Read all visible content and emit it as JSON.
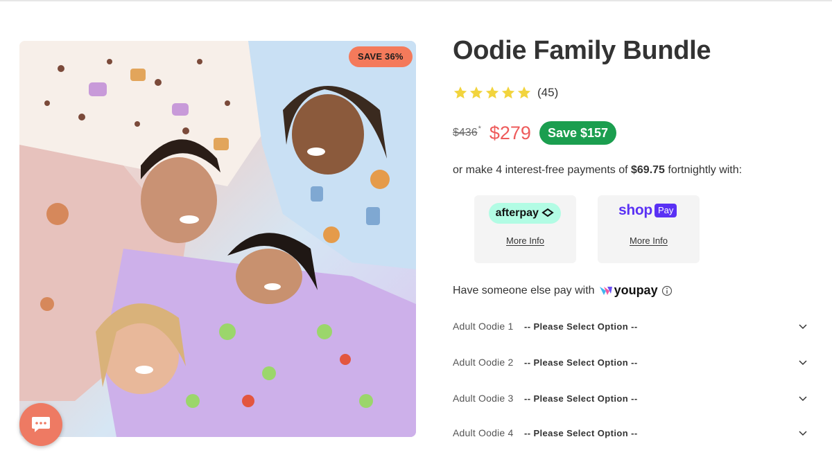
{
  "badge": {
    "save_percent": "SAVE 36%"
  },
  "product": {
    "title": "Oodie Family Bundle",
    "rating": {
      "stars": 5,
      "count": "(45)"
    },
    "price": {
      "old": "$436",
      "old_mark": "*",
      "new": "$279",
      "save": "Save $157"
    },
    "installments": {
      "prefix": "or make 4 interest-free payments of ",
      "amount": "$69.75",
      "suffix": " fortnightly with:"
    }
  },
  "payment_options": {
    "afterpay": {
      "logo_text": "afterpay",
      "link": "More Info"
    },
    "shoppay": {
      "logo_shop": "shop",
      "logo_pay": "Pay",
      "link": "More Info"
    }
  },
  "youpay": {
    "text": "Have someone else pay with",
    "logo_text": "youpay"
  },
  "options": [
    {
      "label": "Adult Oodie 1",
      "value": "-- Please Select Option --"
    },
    {
      "label": "Adult Oodie 2",
      "value": "-- Please Select Option --"
    },
    {
      "label": "Adult Oodie 3",
      "value": "-- Please Select Option --"
    },
    {
      "label": "Adult Oodie 4",
      "value": "-- Please Select Option --"
    }
  ],
  "colors": {
    "badge": "#f47a5b",
    "price_sale": "#ee5b5b",
    "save_pill": "#1b9e4f",
    "star": "#f2d43d",
    "afterpay": "#b2fce4",
    "shoppay": "#5a31f4",
    "chat": "#ee7a63"
  },
  "icons": {
    "star": "star-icon",
    "chevron": "chevron-down-icon",
    "chat": "chat-bubble-icon",
    "info": "info-icon",
    "afterpay_arrows": "afterpay-arrows-icon",
    "youpay_mark": "youpay-mark-icon"
  }
}
